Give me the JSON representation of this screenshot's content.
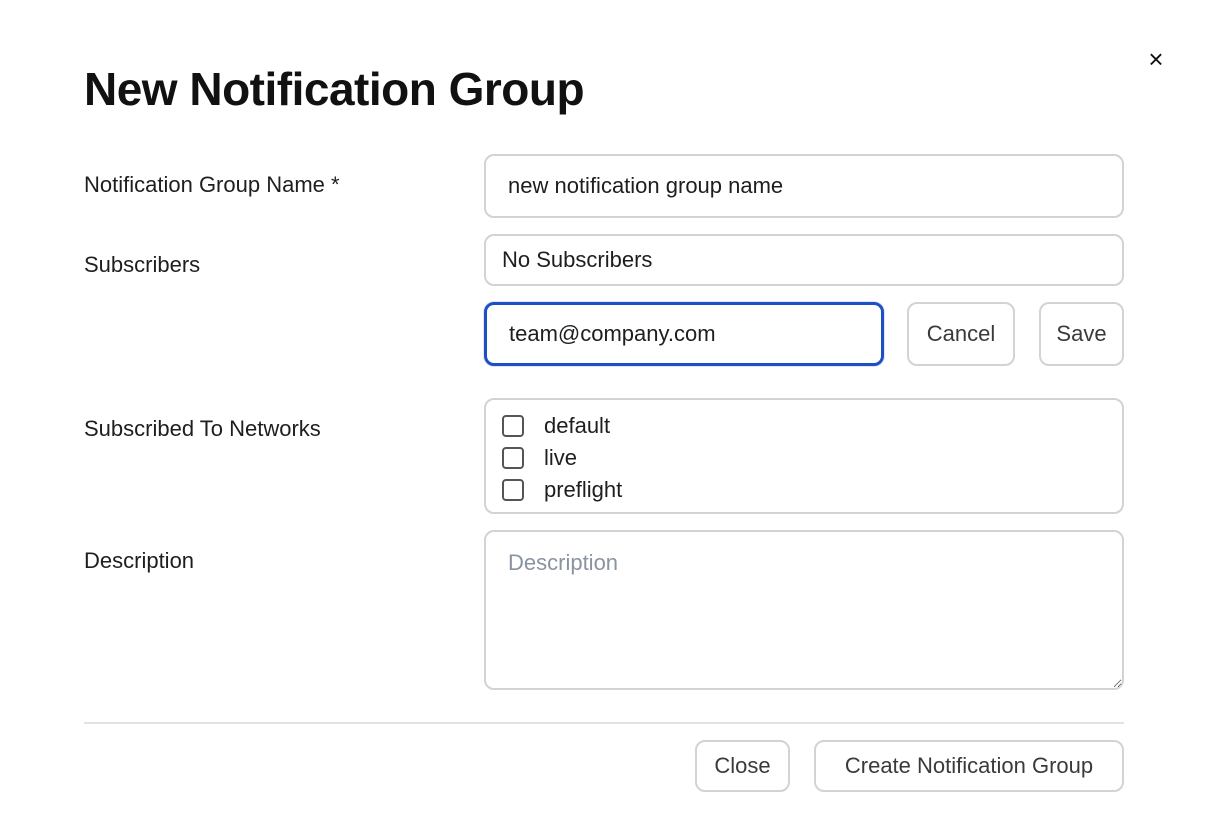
{
  "dialog": {
    "title": "New Notification Group",
    "close_icon": "close-icon",
    "close_glyph": "×"
  },
  "form": {
    "name": {
      "label": "Notification Group Name *",
      "value": "new notification group name"
    },
    "subscribers": {
      "label": "Subscribers",
      "summary": "No Subscribers",
      "new_email_value": "team@company.com",
      "cancel_label": "Cancel",
      "save_label": "Save"
    },
    "networks": {
      "label": "Subscribed To Networks",
      "items": [
        {
          "label": "default",
          "checked": false
        },
        {
          "label": "live",
          "checked": false
        },
        {
          "label": "preflight",
          "checked": false
        }
      ]
    },
    "description": {
      "label": "Description",
      "placeholder": "Description",
      "value": ""
    }
  },
  "footer": {
    "close_label": "Close",
    "create_label": "Create Notification Group"
  },
  "colors": {
    "focus_border": "#1f4fc4",
    "input_border": "#d3d3d3",
    "placeholder": "#8a93a0"
  }
}
